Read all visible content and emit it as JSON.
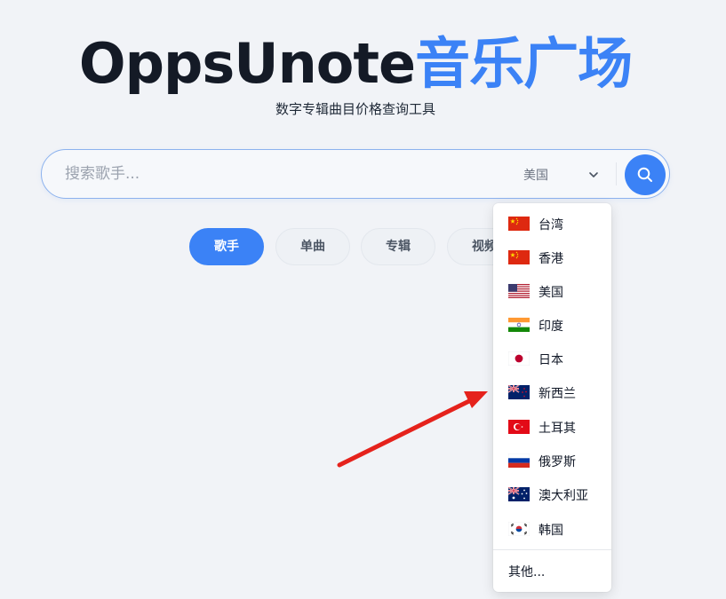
{
  "brand": {
    "name": "OppsUnote",
    "accent": "音乐广场"
  },
  "subtitle": "数字专辑曲目价格查询工具",
  "search": {
    "placeholder": "搜索歌手...",
    "selected_region": "美国"
  },
  "tabs": [
    {
      "label": "歌手",
      "active": true
    },
    {
      "label": "单曲",
      "active": false
    },
    {
      "label": "专辑",
      "active": false
    },
    {
      "label": "视频",
      "active": false
    }
  ],
  "dropdown": {
    "options": [
      {
        "label": "台湾",
        "flag": "flag-cn-icon"
      },
      {
        "label": "香港",
        "flag": "flag-cn-icon"
      },
      {
        "label": "美国",
        "flag": "flag-us-icon"
      },
      {
        "label": "印度",
        "flag": "flag-in-icon"
      },
      {
        "label": "日本",
        "flag": "flag-jp-icon"
      },
      {
        "label": "新西兰",
        "flag": "flag-nz-icon"
      },
      {
        "label": "土耳其",
        "flag": "flag-tr-icon"
      },
      {
        "label": "俄罗斯",
        "flag": "flag-ru-icon"
      },
      {
        "label": "澳大利亚",
        "flag": "flag-au-icon"
      },
      {
        "label": "韩国",
        "flag": "flag-kr-icon"
      }
    ],
    "other_label": "其他..."
  },
  "colors": {
    "accent": "#3b82f6",
    "background": "#f1f3f7",
    "annotation_arrow": "#e5221c"
  }
}
